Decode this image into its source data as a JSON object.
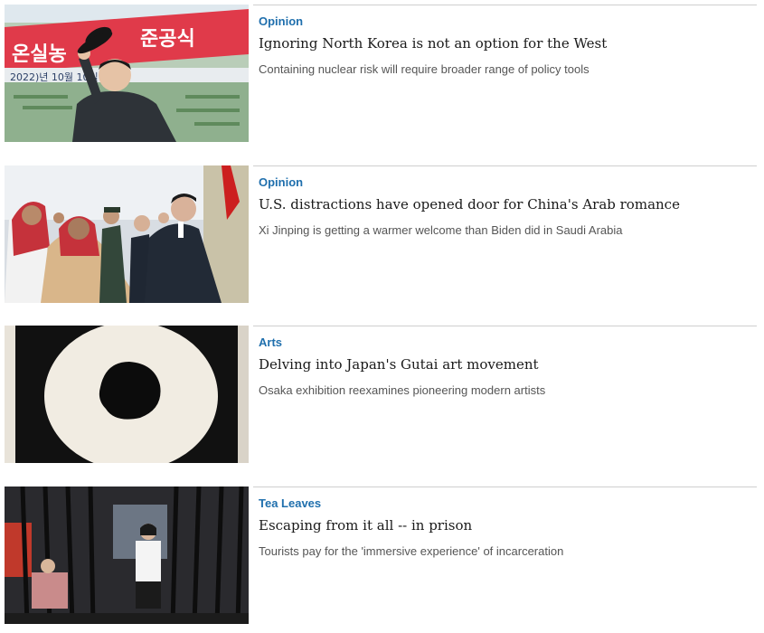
{
  "articles": [
    {
      "category": "Opinion",
      "headline": "Ignoring North Korea is not an option for the West",
      "summary": "Containing nuclear risk will require broader range of policy tools",
      "banner_text": "2022)년 10월 10일",
      "banner_korean": "준공식"
    },
    {
      "category": "Opinion",
      "headline": "U.S. distractions have opened door for China's Arab romance",
      "summary": "Xi Jinping is getting a warmer welcome than Biden did in Saudi Arabia"
    },
    {
      "category": "Arts",
      "headline": "Delving into Japan's Gutai art movement",
      "summary": "Osaka exhibition reexamines pioneering modern artists"
    },
    {
      "category": "Tea Leaves",
      "headline": "Escaping from it all -- in prison",
      "summary": "Tourists pay for the 'immersive experience' of incarceration"
    }
  ],
  "colors": {
    "category": "#1f6fad",
    "headline": "#1a1a1a",
    "summary": "#555555",
    "divider": "#cfcfcf"
  }
}
